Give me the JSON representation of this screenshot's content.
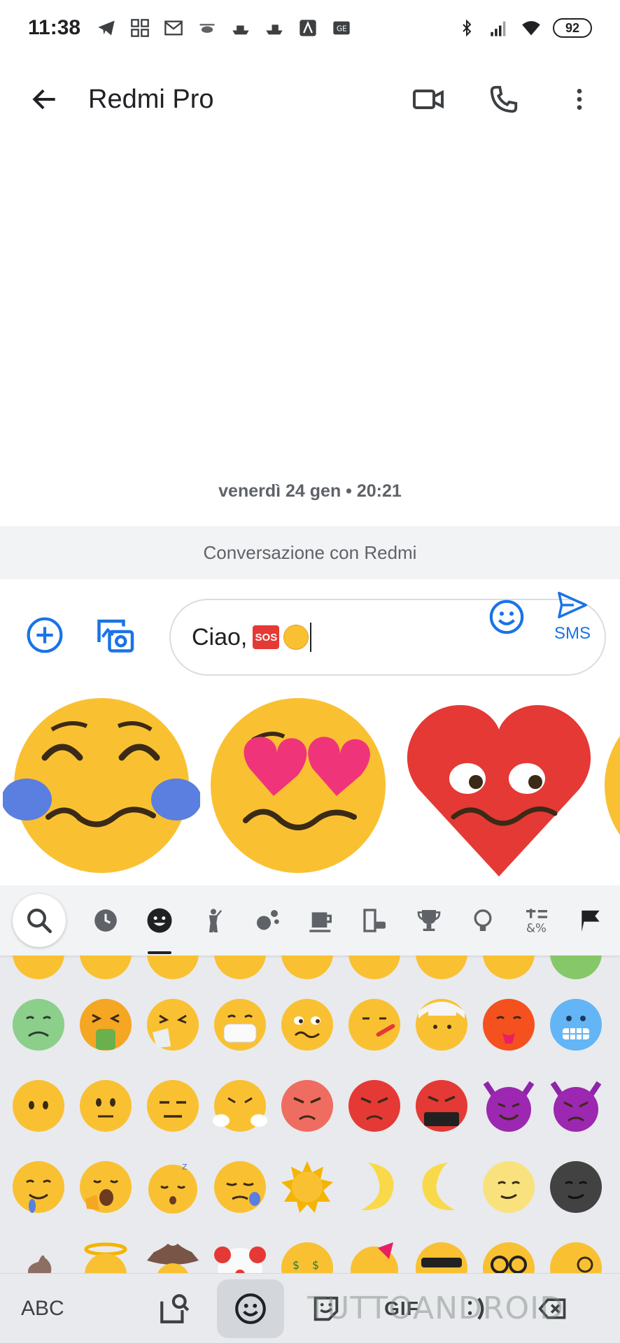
{
  "status_bar": {
    "time": "11:38",
    "battery": "92"
  },
  "app_bar": {
    "title": "Redmi Pro"
  },
  "conversation": {
    "date_separator": "venerdì 24 gen • 20:21",
    "banner": "Conversazione con Redmi"
  },
  "compose": {
    "text": "Ciao,",
    "sos_badge": "SOS",
    "send_label": "SMS"
  },
  "keyboard": {
    "categories": [
      "search-icon",
      "clock-icon",
      "smiley-icon",
      "person-icon",
      "animals-icon",
      "food-icon",
      "travel-icon",
      "activities-icon",
      "objects-icon",
      "symbols-icon",
      "flag-icon"
    ],
    "active_category": "smiley-icon",
    "bottom": {
      "abc_label": "ABC",
      "gif_label": "GIF"
    }
  },
  "watermark": "TUTTOANDROID",
  "colors": {
    "accent": "#1a73e8",
    "emoji_yellow": "#f9c132",
    "heart_red": "#e53935"
  }
}
